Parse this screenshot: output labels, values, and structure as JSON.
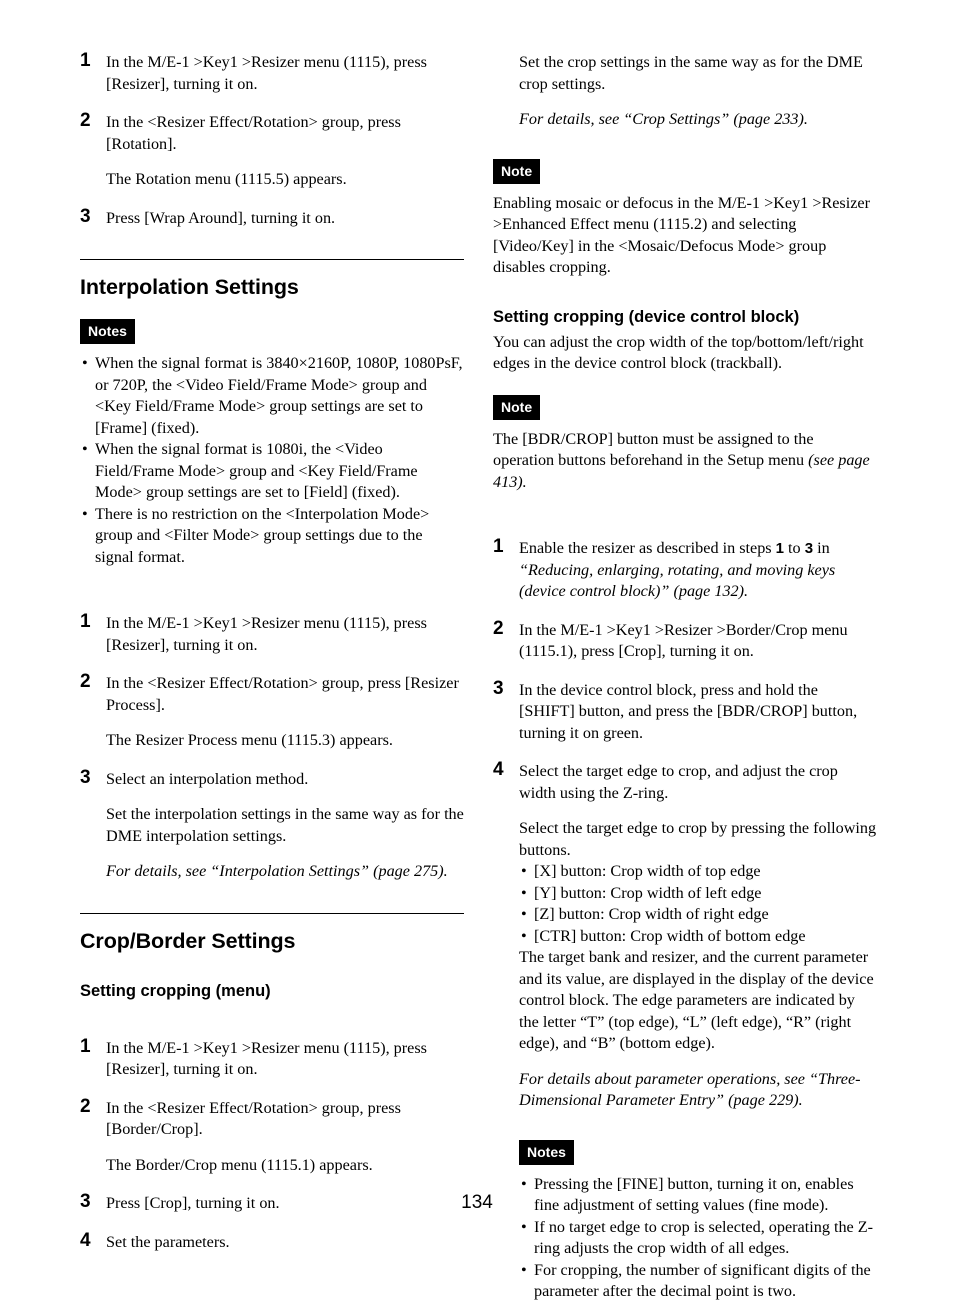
{
  "page": {
    "folio": "134"
  },
  "left_column": {
    "steps_rotation": [
      {
        "num": "1",
        "lines": [
          "In the M/E-1 >Key1 >Resizer menu (1115), press [Resizer], turning it on."
        ]
      },
      {
        "num": "2",
        "lines": [
          "In the <Resizer Effect/Rotation> group, press [Rotation].",
          "The Rotation menu (1115.5) appears."
        ]
      },
      {
        "num": "3",
        "lines": [
          "Press [Wrap Around], turning it on."
        ]
      }
    ],
    "interpolation_section": {
      "heading": "Interpolation Settings",
      "notes_tag": "Notes",
      "notes": [
        "When the signal format is 3840×2160P, 1080P, 1080PsF, or 720P, the <Video Field/Frame Mode> group and <Key Field/Frame Mode> group settings are set to [Frame] (fixed).",
        "When the signal format is 1080i, the <Video Field/Frame Mode> group and <Key Field/Frame Mode> group settings are set to [Field] (fixed).",
        "There is no restriction on the <Interpolation Mode> group and <Filter Mode> group settings due to the signal format."
      ],
      "steps": [
        {
          "num": "1",
          "lines": [
            "In the M/E-1 >Key1 >Resizer menu (1115), press [Resizer], turning it on."
          ]
        },
        {
          "num": "2",
          "lines": [
            "In the <Resizer Effect/Rotation> group, press [Resizer Process].",
            "The Resizer Process menu (1115.3) appears."
          ]
        },
        {
          "num": "3",
          "lines": [
            "Select an interpolation method.",
            "Set the interpolation settings in the same way as for the DME interpolation settings."
          ],
          "reference": "For details, see “Interpolation Settings” (page 275)."
        }
      ]
    },
    "crop_border_section": {
      "heading": "Crop/Border Settings",
      "sub_heading": "Setting cropping (menu)",
      "steps": [
        {
          "num": "1",
          "lines": [
            "In the M/E-1 >Key1 >Resizer menu (1115), press [Resizer], turning it on."
          ]
        },
        {
          "num": "2",
          "lines": [
            "In the <Resizer Effect/Rotation> group, press [Border/Crop].",
            "The Border/Crop menu (1115.1) appears."
          ]
        },
        {
          "num": "3",
          "lines": [
            "Press [Crop], turning it on."
          ]
        },
        {
          "num": "4",
          "lines": [
            "Set the parameters."
          ]
        }
      ]
    }
  },
  "right_column": {
    "continued_step": {
      "body": "Set the crop settings in the same way as for the DME crop settings.",
      "reference": "For details, see “Crop Settings” (page 233)."
    },
    "note_block_1": {
      "tag": "Note",
      "text": "Enabling mosaic or defocus in the M/E-1 >Key1 >Resizer >Enhanced Effect menu (1115.2) and selecting [Video/Key] in the <Mosaic/Defocus Mode> group disables cropping."
    },
    "device_section": {
      "sub_heading": "Setting cropping (device control block)",
      "intro": "You can adjust the crop width of the top/bottom/left/right edges in the device control block (trackball).",
      "note_block": {
        "tag": "Note",
        "text_plain": "The [BDR/CROP] button must be assigned to the operation buttons beforehand in the Setup menu ",
        "text_italic": "(see page 413)."
      },
      "steps": [
        {
          "num": "1",
          "plain": "Enable the resizer as described in steps ",
          "bold_1": "1",
          "mid": " to ",
          "bold_2": "3",
          "tail": " in ",
          "italic": "“Reducing, enlarging, rotating, and moving keys (device control block)” (page 132)."
        },
        {
          "num": "2",
          "lines": [
            "In the M/E-1 >Key1 >Resizer >Border/Crop menu (1115.1), press [Crop], turning it on."
          ]
        },
        {
          "num": "3",
          "lines": [
            "In the device control block, press and hold the [SHIFT] button, and press the [BDR/CROP] button, turning it on green."
          ]
        },
        {
          "num": "4",
          "lines": [
            "Select the target edge to crop, and adjust the crop width using the Z-ring.",
            "Select the target edge to crop by pressing the following buttons."
          ],
          "bullets": [
            "[X] button: Crop width of top edge",
            "[Y] button: Crop width of left edge",
            "[Z] button: Crop width of right edge",
            "[CTR] button: Crop width of bottom edge"
          ],
          "after_bullets": "The target bank and resizer, and the current parameter and its value, are displayed in the display of the device control block. The edge parameters are indicated by the letter “T” (top edge), “L” (left edge), “R” (right edge), and “B” (bottom edge).",
          "reference": "For details about parameter operations, see “Three-Dimensional Parameter Entry” (page 229)."
        }
      ]
    },
    "notes_block_final": {
      "tag": "Notes",
      "notes": [
        "Pressing the [FINE] button, turning it on, enables fine adjustment of setting values (fine mode).",
        "If no target edge to crop is selected, operating the Z-ring adjusts the crop width of all edges.",
        "For cropping, the number of significant digits of the parameter after the decimal point is two."
      ]
    }
  }
}
